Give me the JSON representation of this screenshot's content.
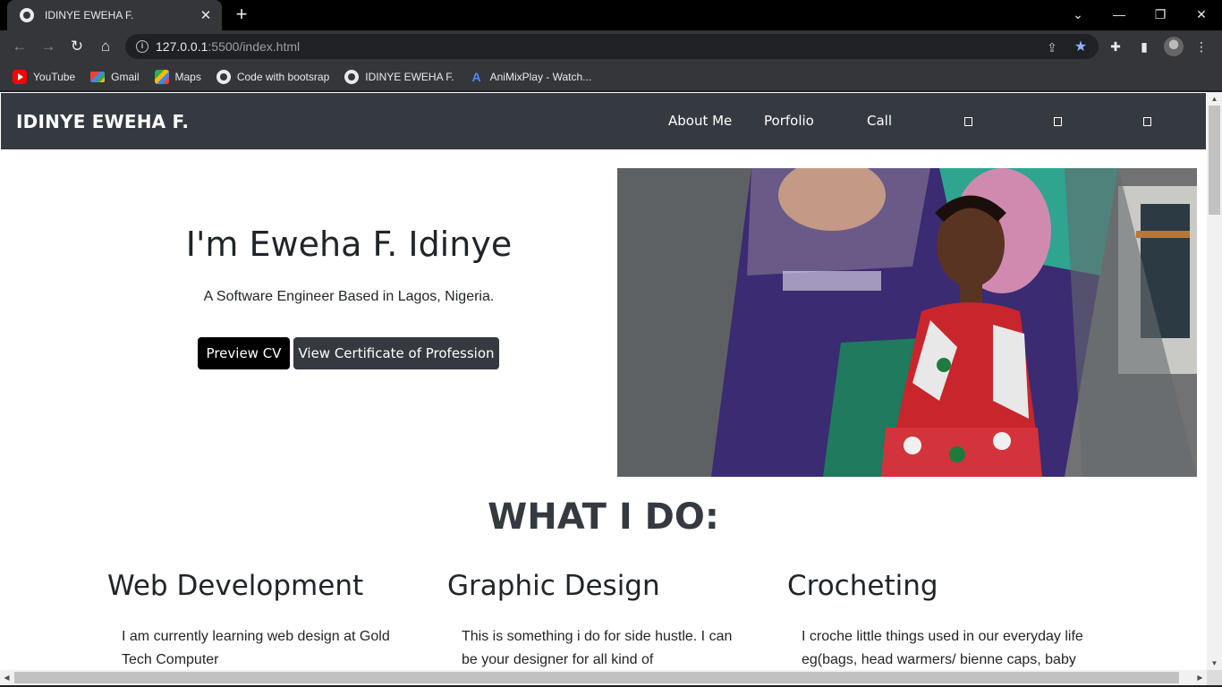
{
  "browser": {
    "tab_title": "IDINYE EWEHA F.",
    "tab_close": "✕",
    "new_tab": "+",
    "window_controls": [
      "⌄",
      "—",
      "❐",
      "✕"
    ],
    "url_host": "127.0.0.1",
    "url_path": ":5500/index.html",
    "bookmarks": [
      {
        "label": "YouTube",
        "icon": "youtube-icon"
      },
      {
        "label": "Gmail",
        "icon": "gmail-icon"
      },
      {
        "label": "Maps",
        "icon": "maps-icon"
      },
      {
        "label": "Code with bootsrap",
        "icon": "globe-icon"
      },
      {
        "label": "IDINYE EWEHA F.",
        "icon": "globe-icon"
      },
      {
        "label": "AniMixPlay - Watch...",
        "icon": "animixplay-icon"
      }
    ]
  },
  "site": {
    "brand": "IDINYE EWEHA F.",
    "nav": [
      "About Me",
      "Porfolio",
      "Call"
    ],
    "hero": {
      "title": "I'm Eweha F. Idinye",
      "subtitle": "A Software Engineer Based in Lagos, Nigeria.",
      "buttons": [
        "Preview CV",
        "View Certificate of Profession"
      ]
    },
    "section_title": "WHAT I DO:",
    "services": [
      {
        "title": "Web Development",
        "text": "I am currently learning web design at Gold Tech Computer"
      },
      {
        "title": "Graphic Design",
        "text": "This is something i do for side hustle. I can be your designer for all kind of"
      },
      {
        "title": "Crocheting",
        "text": "I croche little things used in our everyday life eg(bags, head warmers/ bienne caps, baby"
      }
    ]
  },
  "colors": {
    "navbar": "#343a40",
    "button_dark": "#000000",
    "button_secondary": "#343a40",
    "star_bookmarked": "#8ab4f8"
  }
}
